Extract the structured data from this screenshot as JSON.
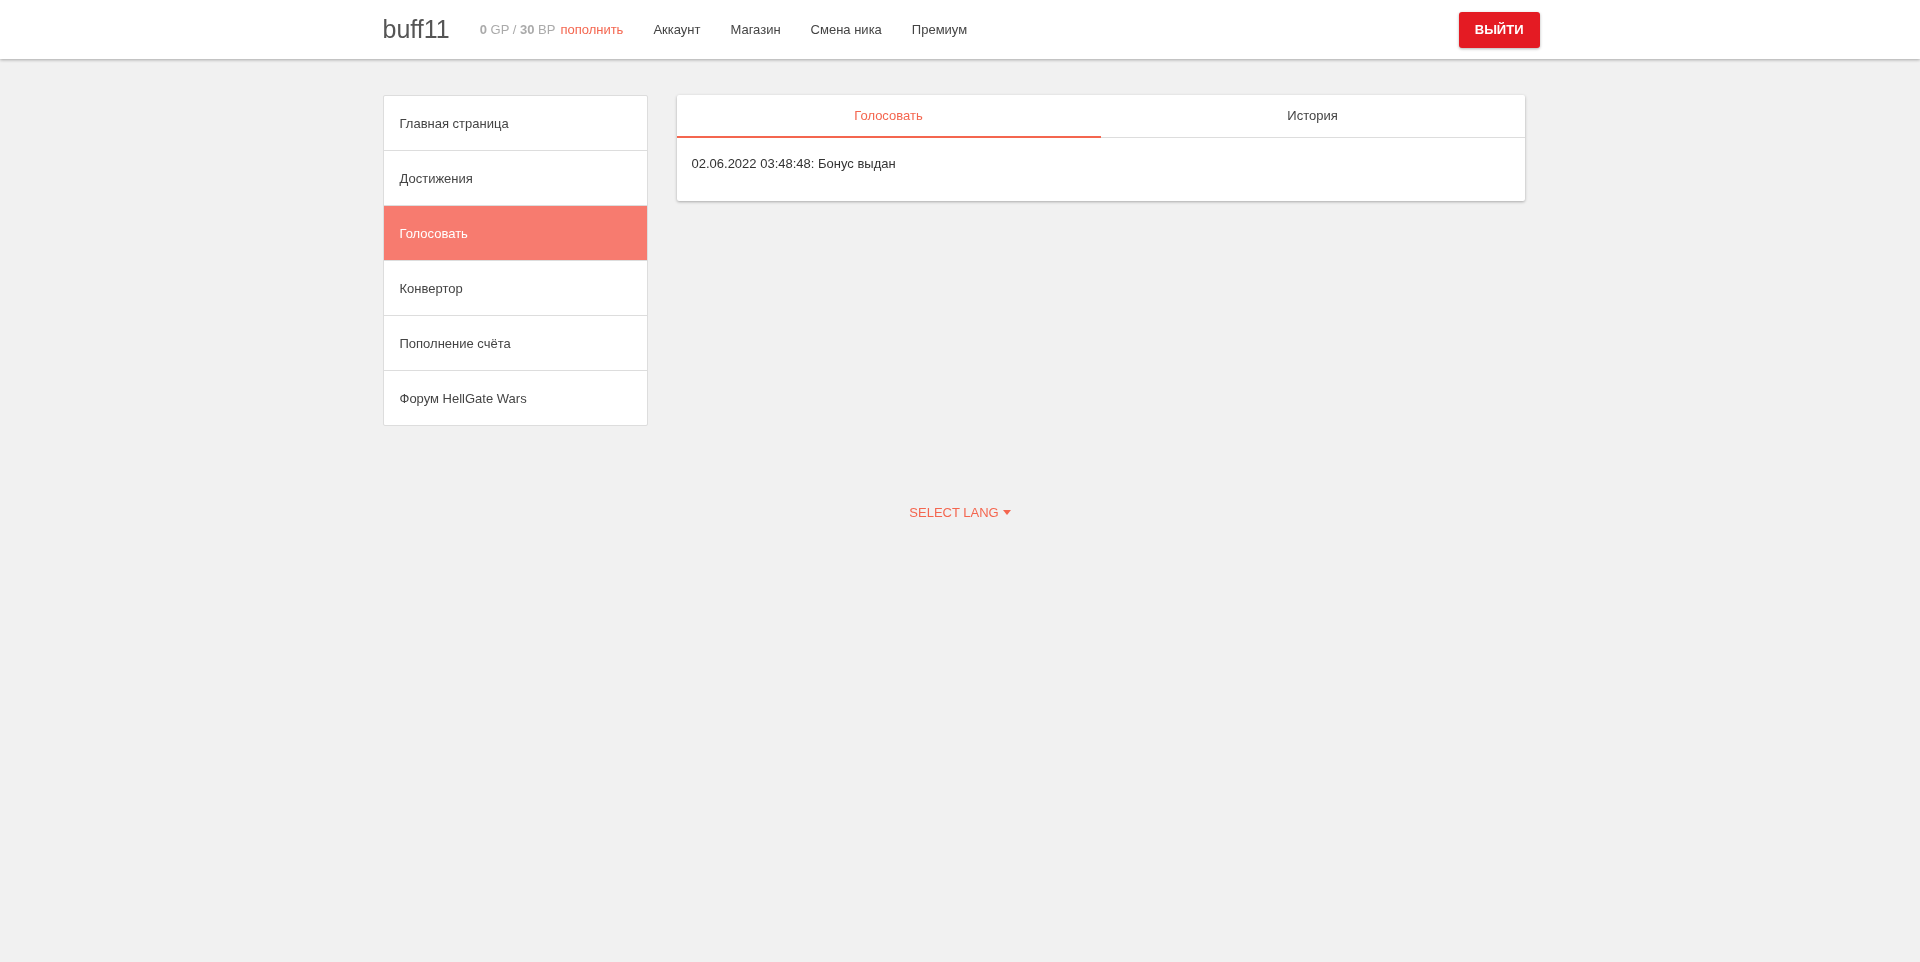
{
  "header": {
    "username": "buff11",
    "balance": "**0** GP / **30** BP",
    "topup_link": "пополнить",
    "nav": [
      "Аккаунт",
      "Магазин",
      "Смена ника",
      "Премиум"
    ],
    "logout_button": "ВЫЙТИ"
  },
  "sidebar": {
    "items": [
      {
        "label": "Главная страница",
        "selected": false
      },
      {
        "label": "Достижения",
        "selected": false
      },
      {
        "label": "Голосовать",
        "selected": true
      },
      {
        "label": "Конвертор",
        "selected": false
      },
      {
        "label": "Пополнение счёта",
        "selected": false
      },
      {
        "label": "Форум HellGate Wars",
        "selected": false
      }
    ]
  },
  "panel": {
    "tabs": [
      {
        "label": "Голосовать",
        "selected": true
      },
      {
        "label": "История",
        "selected": false
      }
    ],
    "log": [
      "02.06.2022 03:48:48: Бонус выдан"
    ]
  },
  "footer": {
    "lang_select": "SELECT LANG"
  }
}
